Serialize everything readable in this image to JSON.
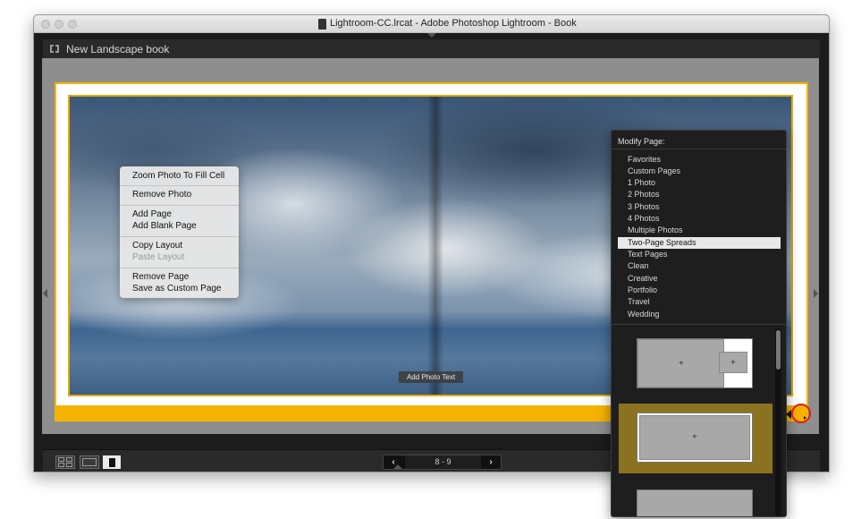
{
  "window": {
    "title": "Lightroom-CC.lrcat - Adobe Photoshop Lightroom - Book"
  },
  "book": {
    "title": "New Landscape book"
  },
  "photo": {
    "add_text_label": "Add Photo Text"
  },
  "context_menu": {
    "items": [
      {
        "label": "Zoom Photo To Fill Cell",
        "disabled": false
      },
      {
        "label": "Remove Photo",
        "disabled": false
      },
      {
        "label": "Add Page",
        "disabled": false
      },
      {
        "label": "Add Blank Page",
        "disabled": false
      },
      {
        "label": "Copy Layout",
        "disabled": false
      },
      {
        "label": "Paste Layout",
        "disabled": true
      },
      {
        "label": "Remove Page",
        "disabled": false
      },
      {
        "label": "Save as Custom Page",
        "disabled": false
      }
    ]
  },
  "pager": {
    "label": "8 - 9",
    "prev_icon": "chevron-left-icon",
    "next_icon": "chevron-right-icon"
  },
  "view_modes": [
    "multi-page-view",
    "spread-view",
    "single-page-view"
  ],
  "modify_page": {
    "header": "Modify Page:",
    "items": [
      {
        "label": "Favorites",
        "selected": false
      },
      {
        "label": "Custom Pages",
        "selected": false
      },
      {
        "label": "1 Photo",
        "selected": false
      },
      {
        "label": "2 Photos",
        "selected": false
      },
      {
        "label": "3 Photos",
        "selected": false
      },
      {
        "label": "4 Photos",
        "selected": false
      },
      {
        "label": "Multiple Photos",
        "selected": false
      },
      {
        "label": "Two-Page Spreads",
        "selected": true
      },
      {
        "label": "Text Pages",
        "selected": false
      },
      {
        "label": "Clean",
        "selected": false
      },
      {
        "label": "Creative",
        "selected": false
      },
      {
        "label": "Portfolio",
        "selected": false
      },
      {
        "label": "Travel",
        "selected": false
      },
      {
        "label": "Wedding",
        "selected": false
      }
    ],
    "thumb_plus": "+"
  },
  "colors": {
    "accent": "#f5b300",
    "highlight": "#e01a1a",
    "selected_thumb": "#8a7220"
  }
}
